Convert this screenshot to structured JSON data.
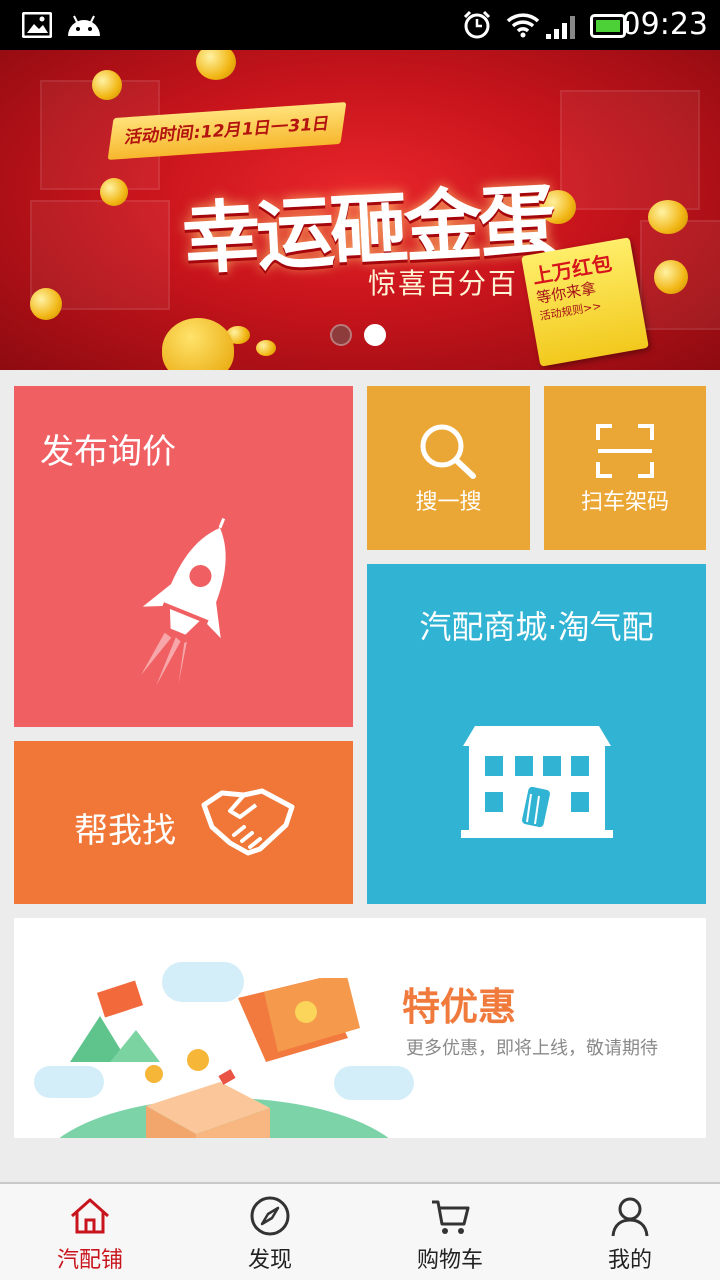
{
  "status_bar": {
    "time": "09:23",
    "icons": [
      "image-icon",
      "android-icon",
      "alarm-icon",
      "wifi-icon",
      "signal-icon",
      "battery-icon"
    ]
  },
  "banner": {
    "date_tag": "活动时间:12月1日一31日",
    "title": "幸运砸金蛋",
    "subtitle": "惊喜百分百",
    "badge_line1": "上万红包",
    "badge_line2": "等你来拿",
    "badge_line3": "活动规则>>",
    "carousel_active_index": 1,
    "carousel_count": 2
  },
  "tiles": {
    "publish": {
      "label": "发布询价",
      "icon": "rocket-icon",
      "color": "#f06063"
    },
    "search": {
      "label": "搜一搜",
      "icon": "search-icon",
      "color": "#eba735"
    },
    "scan": {
      "label": "扫车架码",
      "icon": "scan-icon",
      "color": "#eba735"
    },
    "mall": {
      "label": "汽配商城·淘气配",
      "icon": "store-icon",
      "color": "#31b3d3"
    },
    "help": {
      "label": "帮我找",
      "icon": "handshake-icon",
      "color": "#f07737"
    }
  },
  "promo": {
    "title": "特优惠",
    "subtitle": "更多优惠，即将上线，敬请期待"
  },
  "bottom_nav": {
    "active_color": "#c8141c",
    "items": [
      {
        "label": "汽配铺",
        "icon": "home-icon",
        "active": true
      },
      {
        "label": "发现",
        "icon": "compass-icon",
        "active": false
      },
      {
        "label": "购物车",
        "icon": "cart-icon",
        "active": false
      },
      {
        "label": "我的",
        "icon": "user-icon",
        "active": false
      }
    ]
  }
}
